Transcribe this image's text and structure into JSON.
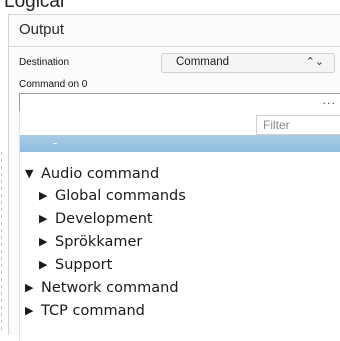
{
  "header_cut": "Logical",
  "panel": {
    "title": "Output",
    "destination_label": "Destination",
    "destination_value": "Command",
    "command_label": "Command on 0",
    "command_value": "",
    "more_button": "..."
  },
  "chooser": {
    "filter_placeholder": "Filter",
    "selected_item": "-",
    "tree": [
      {
        "label": "Audio command",
        "expanded": true,
        "children": [
          {
            "label": "Global commands"
          },
          {
            "label": "Development"
          },
          {
            "label": "Sprökkamer"
          },
          {
            "label": "Support"
          }
        ]
      },
      {
        "label": "Network command",
        "expanded": false
      },
      {
        "label": "TCP command",
        "expanded": false
      }
    ]
  },
  "icons": {
    "expanded": "triangle-down-icon",
    "collapsed": "triangle-right-icon",
    "select": "up-down-chevron-icon"
  }
}
